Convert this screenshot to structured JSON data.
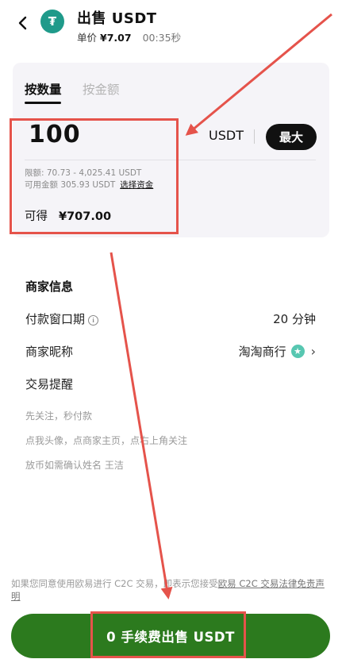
{
  "header": {
    "title": "出售 USDT",
    "unit_price_label": "单价",
    "unit_price_value": "¥7.07",
    "timer": "00:35秒",
    "coin_symbol": "₮"
  },
  "tabs": [
    {
      "label": "按数量",
      "active": true
    },
    {
      "label": "按金额",
      "active": false
    }
  ],
  "amount_input": {
    "value": "100",
    "unit": "USDT",
    "max_label": "最大"
  },
  "limits": {
    "limit_text": "限额: 70.73 - 4,025.41 USDT",
    "available_text": "可用金额 305.93 USDT",
    "select_funds": "选择资金"
  },
  "receive": {
    "label": "可得",
    "value": "¥707.00"
  },
  "merchant_info": {
    "title": "商家信息",
    "payment_window_label": "付款窗口期",
    "payment_window_value": "20 分钟",
    "merchant_name_label": "商家昵称",
    "merchant_name_value": "淘淘商行",
    "trade_note_label": "交易提醒",
    "notes": [
      "先关注，秒付款",
      "点我头像，点商家主页，点右上角关注",
      "放币如需确认姓名 王洁"
    ]
  },
  "legal": {
    "prefix": "如果您同意使用欧易进行 C2C 交易，即表示您接受",
    "link": "欧易 C2C 交易法律免责声明"
  },
  "sell_button": {
    "label": "0 手续费出售 USDT"
  },
  "colors": {
    "accent_green": "#2c7a1e",
    "annotation_red": "#e5534b",
    "coin_teal": "#1f9a8a"
  },
  "icons": {
    "back": "back-chevron-icon",
    "coin": "usdt-coin-icon",
    "info": "info-icon",
    "badge": "verified-badge-icon",
    "chevron": "chevron-right-icon"
  }
}
